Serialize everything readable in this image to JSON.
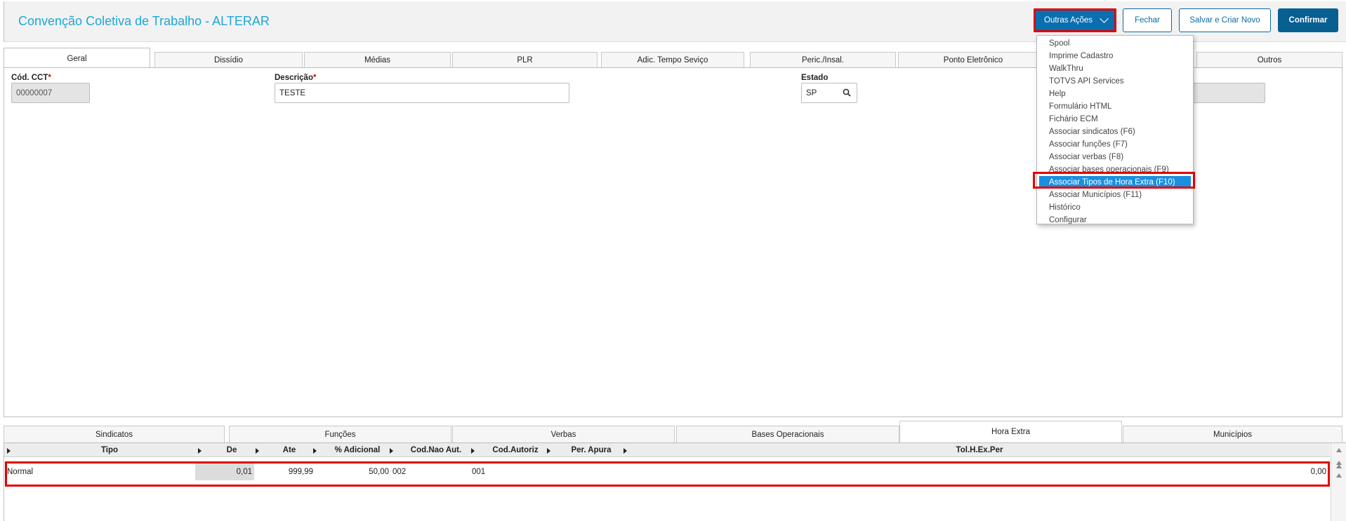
{
  "header": {
    "title": "Convenção Coletiva de Trabalho - ALTERAR",
    "buttons": {
      "outras_acoes": "Outras Ações",
      "fechar": "Fechar",
      "salvar_criar_novo": "Salvar e Criar Novo",
      "confirmar": "Confirmar"
    }
  },
  "tabs": [
    "Geral",
    "Dissídio",
    "Médias",
    "PLR",
    "Adic. Tempo Seviço",
    "Peric./Insal.",
    "Ponto Eletrônico",
    "Outros"
  ],
  "fields": {
    "cod_cct": {
      "label": "Cód. CCT",
      "required": "*",
      "value": "00000007"
    },
    "descricao": {
      "label": "Descrição",
      "required": "*",
      "value": "TESTE"
    },
    "estado": {
      "label": "Estado",
      "value": "SP"
    }
  },
  "menu": {
    "items": [
      "Spool",
      "Imprime Cadastro",
      "WalkThru",
      "TOTVS API Services",
      "Help",
      "Formulário HTML",
      "Fichário ECM",
      "Associar sindicatos (F6)",
      "Associar funções (F7)",
      "Associar verbas (F8)",
      "Associar bases operacionais (F9)",
      "Associar Tipos de Hora Extra (F10)",
      "Associar Municípios (F11)",
      "Histórico",
      "Configurar"
    ],
    "active_item": "Associar Tipos de Hora Extra (F10)"
  },
  "lower_tabs": [
    "Sindicatos",
    "Funções",
    "Verbas",
    "Bases Operacionais",
    "Hora Extra",
    "Municípios"
  ],
  "lower_active_tab": "Hora Extra",
  "grid": {
    "columns": [
      "Tipo",
      "De",
      "Ate",
      "% Adicional",
      "Cod.Nao Aut.",
      "Cod.Autoriz",
      "Per. Apura",
      "Tol.H.Ex.Per"
    ],
    "rows": [
      {
        "tipo": "Normal",
        "de": "0,01",
        "ate": "999,99",
        "adicional": "50,00",
        "cod_nao_aut": "002",
        "cod_autoriz": "001",
        "per_apura": "",
        "tol": "0,00"
      }
    ]
  },
  "colors": {
    "title": "#1ea7d6",
    "primary": "#075f92",
    "highlight": "#e10000",
    "menu_active": "#1a8fe0"
  }
}
